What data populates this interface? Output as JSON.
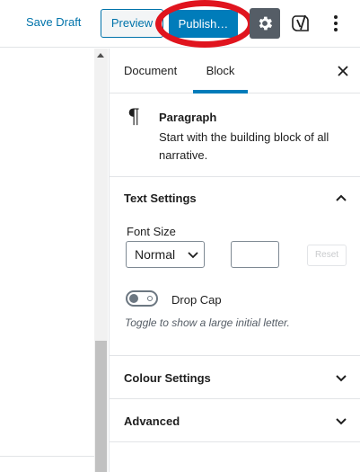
{
  "header": {
    "save_draft": "Save Draft",
    "preview": "Preview",
    "publish": "Publish…",
    "settings_icon": "gear-icon",
    "yoast_icon": "yoast-icon",
    "more_icon": "more-vertical-icon"
  },
  "sidebar": {
    "tabs": [
      {
        "label": "Document"
      },
      {
        "label": "Block"
      }
    ],
    "active_tab": "Block",
    "block": {
      "icon": "¶",
      "title": "Paragraph",
      "description": "Start with the building block of all narrative."
    },
    "text_settings": {
      "title": "Text Settings",
      "font_size_label": "Font Size",
      "font_size_value": "Normal",
      "custom_size_value": "",
      "reset_label": "Reset",
      "drop_cap_label": "Drop Cap",
      "drop_cap_enabled": false,
      "help_text": "Toggle to show a large initial letter."
    },
    "colour_settings": {
      "title": "Colour Settings"
    },
    "advanced": {
      "title": "Advanced"
    }
  },
  "colors": {
    "accent": "#007cba",
    "highlight_ring": "#e0141e",
    "settings_button_bg": "#555d66"
  }
}
